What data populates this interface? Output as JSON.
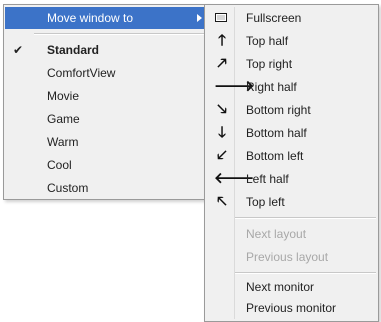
{
  "main_menu": {
    "move_window_to": "Move window to",
    "items": [
      {
        "label": "Standard",
        "checked": true,
        "check_glyph": "✔"
      },
      {
        "label": "ComfortView"
      },
      {
        "label": "Movie"
      },
      {
        "label": "Game"
      },
      {
        "label": "Warm"
      },
      {
        "label": "Cool"
      },
      {
        "label": "Custom"
      }
    ]
  },
  "sub_menu": {
    "positions": [
      {
        "label": "Fullscreen",
        "icon": "fullscreen-icon",
        "glyph": ""
      },
      {
        "label": "Top half",
        "icon": "arrow-up-icon",
        "glyph": "🡑"
      },
      {
        "label": "Top right",
        "icon": "arrow-up-right-icon",
        "glyph": "🡕"
      },
      {
        "label": "Right half",
        "icon": "arrow-right-icon",
        "glyph": "🡒"
      },
      {
        "label": "Bottom right",
        "icon": "arrow-down-right-icon",
        "glyph": "🡖"
      },
      {
        "label": "Bottom half",
        "icon": "arrow-down-icon",
        "glyph": "🡓"
      },
      {
        "label": "Bottom left",
        "icon": "arrow-down-left-icon",
        "glyph": "🡗"
      },
      {
        "label": "Left half",
        "icon": "arrow-left-icon",
        "glyph": "🡐"
      },
      {
        "label": "Top left",
        "icon": "arrow-up-left-icon",
        "glyph": "🡔"
      }
    ],
    "layout_items": [
      {
        "label": "Next layout",
        "disabled": true
      },
      {
        "label": "Previous layout",
        "disabled": true
      }
    ],
    "monitor_items": [
      {
        "label": "Next monitor"
      },
      {
        "label": "Previous monitor"
      }
    ]
  },
  "colors": {
    "highlight": "#3c73c8",
    "menu_background": "#f0f0f0",
    "disabled_text": "#a8a8a8"
  }
}
